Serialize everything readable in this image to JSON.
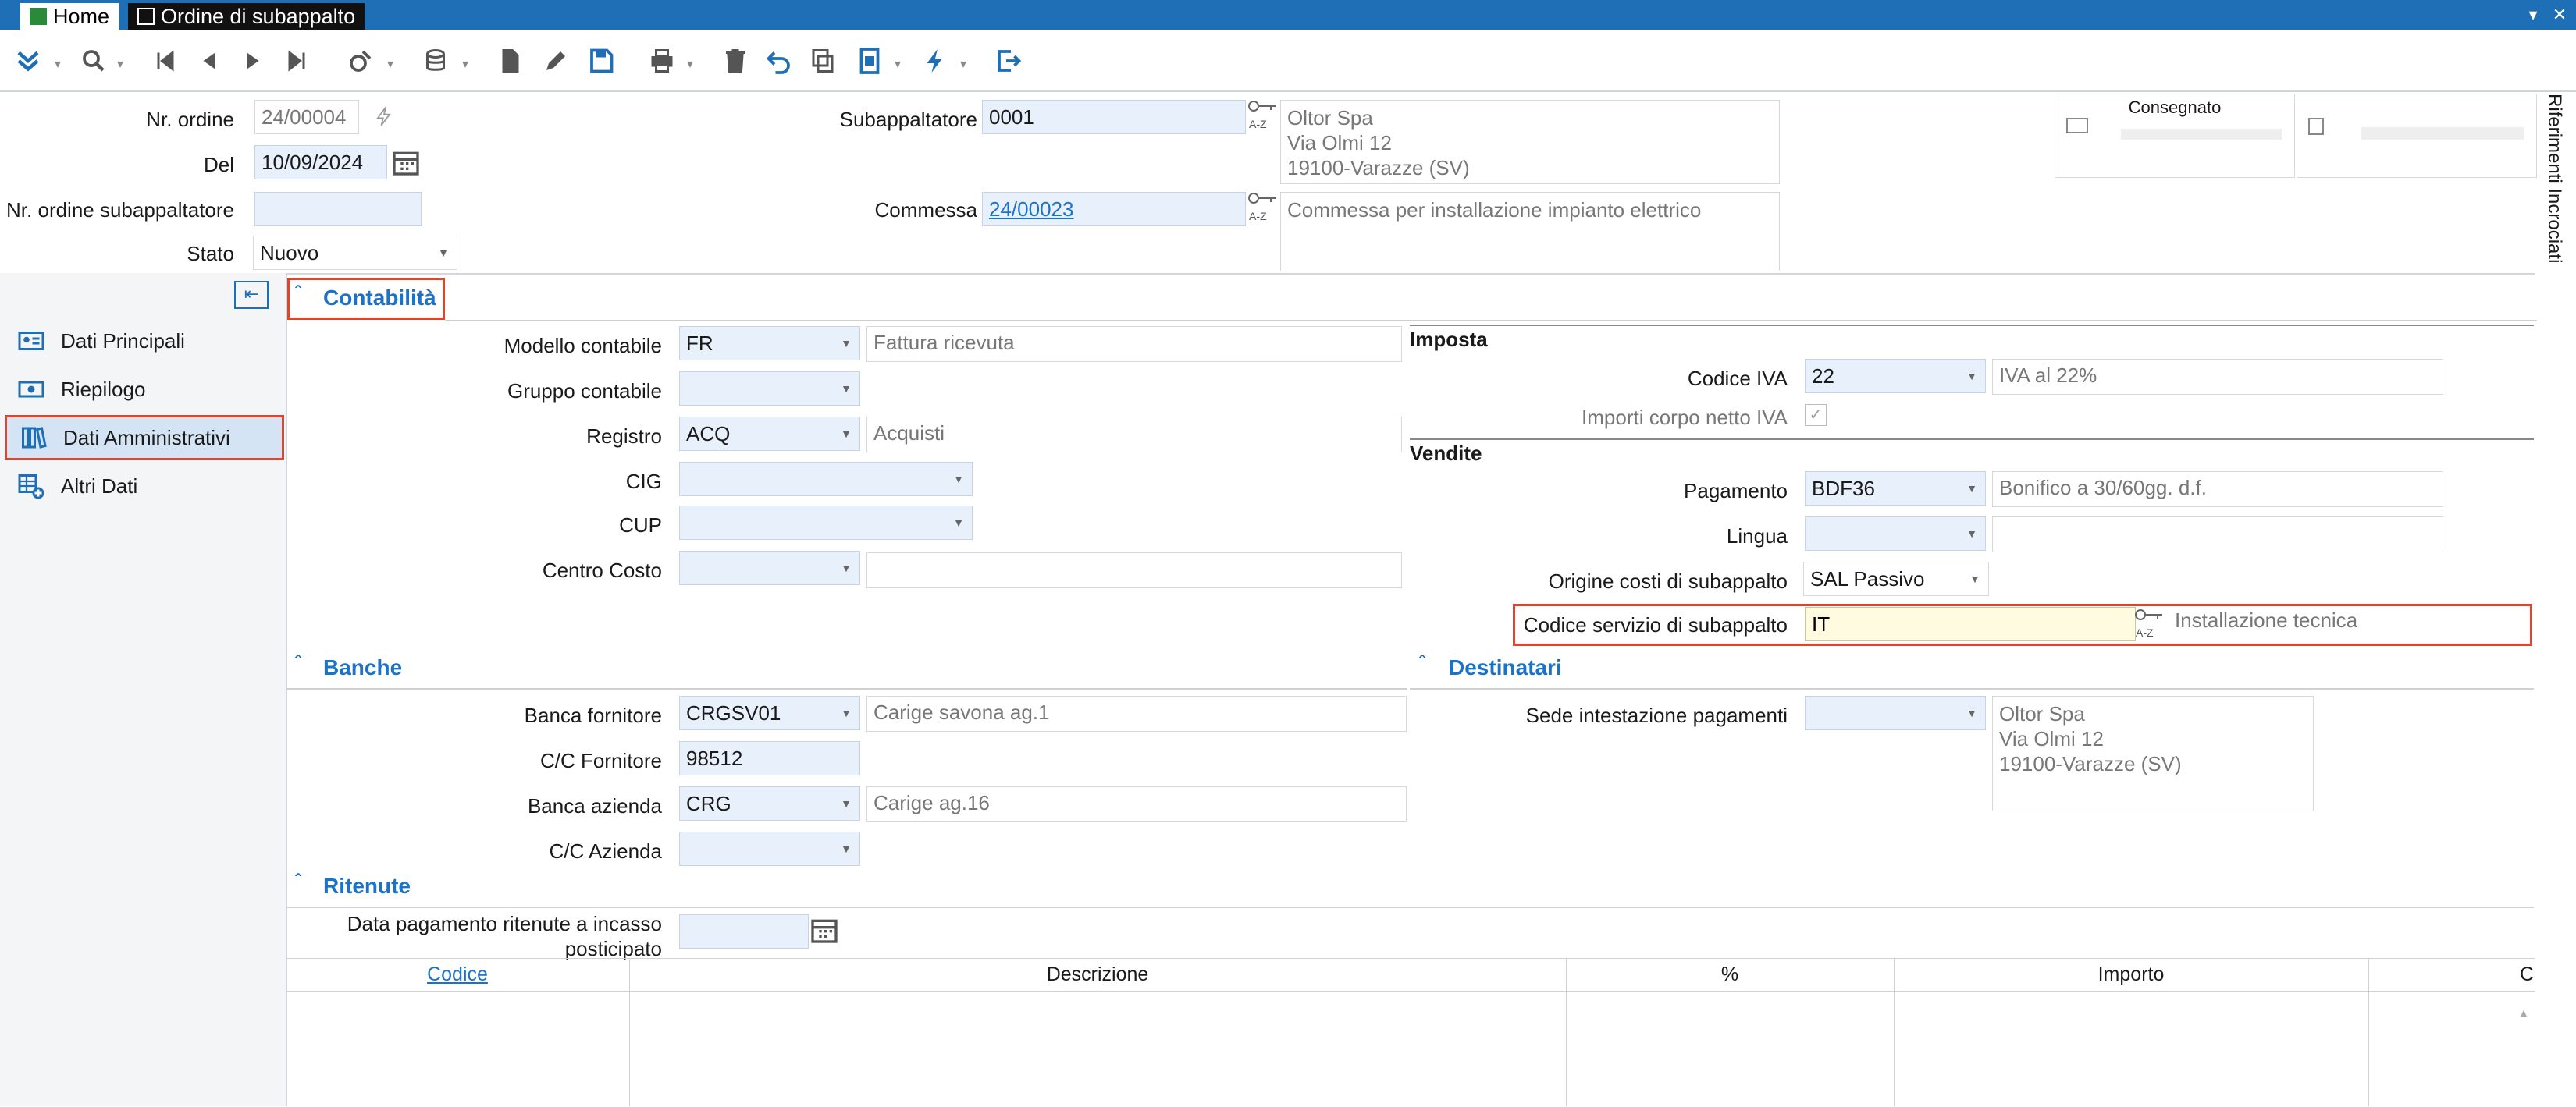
{
  "window": {
    "tab_home": "Home",
    "tab_active": "Ordine di subappalto"
  },
  "header": {
    "nr_ordine_label": "Nr. ordine",
    "nr_ordine_value": "24/00004",
    "del_label": "Del",
    "del_value": "10/09/2024",
    "nr_ordine_sub_label": "Nr. ordine subappaltatore",
    "nr_ordine_sub_value": "",
    "stato_label": "Stato",
    "stato_value": "Nuovo",
    "subappaltatore_label": "Subappaltatore",
    "subappaltatore_value": "0001",
    "subappaltatore_desc": "Oltor Spa\nVia Olmi 12\n19100-Varazze (SV)",
    "commessa_label": "Commessa",
    "commessa_value": "24/00023",
    "commessa_desc": "Commessa per installazione impianto elettrico",
    "consegnato_label": "Consegnato",
    "side_tab": "Riferimenti Incrociati"
  },
  "nav": {
    "items": [
      {
        "label": "Dati Principali"
      },
      {
        "label": "Riepilogo"
      },
      {
        "label": "Dati Amministrativi"
      },
      {
        "label": "Altri Dati"
      }
    ]
  },
  "contabilita": {
    "title": "Contabilità",
    "modello_label": "Modello contabile",
    "modello_value": "FR",
    "modello_desc": "Fattura ricevuta",
    "gruppo_label": "Gruppo contabile",
    "gruppo_value": "",
    "registro_label": "Registro",
    "registro_value": "ACQ",
    "registro_desc": "Acquisti",
    "cig_label": "CIG",
    "cup_label": "CUP",
    "centro_label": "Centro Costo",
    "imposta_title": "Imposta",
    "codice_iva_label": "Codice IVA",
    "codice_iva_value": "22",
    "codice_iva_desc": "IVA al 22%",
    "importi_label": "Importi corpo netto IVA",
    "vendite_title": "Vendite",
    "pagamento_label": "Pagamento",
    "pagamento_value": "BDF36",
    "pagamento_desc": "Bonifico a 30/60gg. d.f.",
    "lingua_label": "Lingua",
    "origine_label": "Origine costi di subappalto",
    "origine_value": "SAL Passivo",
    "codice_servizio_label": "Codice servizio di subappalto",
    "codice_servizio_value": "IT",
    "codice_servizio_desc": "Installazione tecnica"
  },
  "banche": {
    "title": "Banche",
    "banca_fornitore_label": "Banca fornitore",
    "banca_fornitore_value": "CRGSV01",
    "banca_fornitore_desc": "Carige savona ag.1",
    "cc_fornitore_label": "C/C Fornitore",
    "cc_fornitore_value": "98512",
    "banca_azienda_label": "Banca azienda",
    "banca_azienda_value": "CRG",
    "banca_azienda_desc": "Carige ag.16",
    "cc_azienda_label": "C/C Azienda"
  },
  "destinatari": {
    "title": "Destinatari",
    "sede_label": "Sede intestazione pagamenti",
    "sede_desc": "Oltor Spa\nVia Olmi 12\n19100-Varazze (SV)"
  },
  "ritenute": {
    "title": "Ritenute",
    "data_label_1": "Data pagamento ritenute a incasso",
    "data_label_2": "posticipato",
    "columns": [
      "Codice",
      "Descrizione",
      "%",
      "Importo",
      "C"
    ]
  },
  "colors": {
    "accent": "#1a73c8",
    "titlebar": "#1f6fb6",
    "highlight": "#e0442b",
    "field_bg": "#e8f0fb",
    "active_field_bg": "#fffbe0"
  }
}
